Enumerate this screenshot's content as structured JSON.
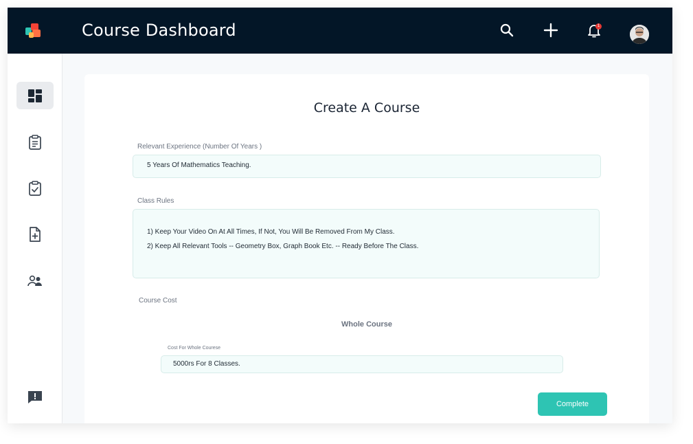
{
  "header": {
    "title": "Course Dashboard",
    "notification_count": "1",
    "icons": [
      "app-logo-icon",
      "search-icon",
      "plus-icon",
      "bell-icon",
      "avatar"
    ]
  },
  "sidebar": {
    "items": [
      {
        "name": "dashboard-icon",
        "active": true
      },
      {
        "name": "clipboard-icon",
        "active": false
      },
      {
        "name": "clipboard-check-icon",
        "active": false
      },
      {
        "name": "file-add-icon",
        "active": false
      },
      {
        "name": "users-icon",
        "active": false
      }
    ],
    "feedback_icon": "message-alert-icon"
  },
  "form": {
    "title": "Create A Course",
    "experience": {
      "label": "Relevant Experience (Number Of Years )",
      "value": "5 Years Of Mathematics Teaching."
    },
    "rules": {
      "label": "Class Rules",
      "lines": [
        "1) Keep Your Video On At All Times, If Not, You Will Be Removed From My Class.",
        "2) Keep All Relevant Tools -- Geometry Box, Graph Book Etc. -- Ready Before The Class."
      ]
    },
    "cost": {
      "label": "Course Cost",
      "section_heading": "Whole Course",
      "field_label": "Cost For Whole Courese",
      "value": "5000rs For 8 Classes."
    },
    "submit_label": "Complete"
  },
  "colors": {
    "topbar": "#031627",
    "accent": "#2ec4b3",
    "field_bg": "#f3fcfb"
  }
}
